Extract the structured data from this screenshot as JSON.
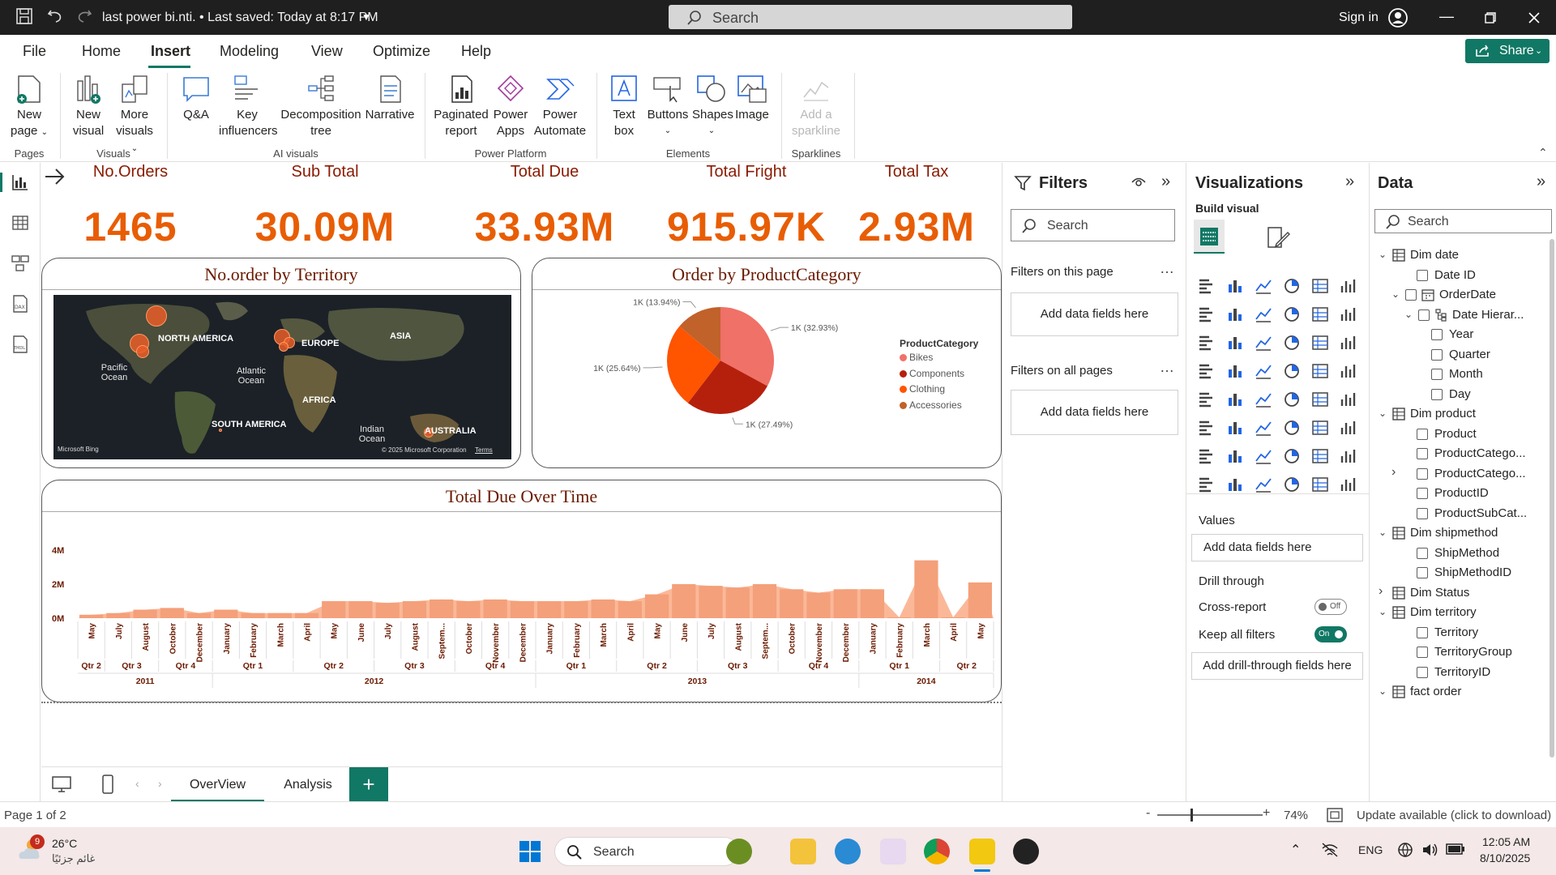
{
  "titlebar": {
    "doc_title": "last power bi.nti. • Last saved: Today at 8:17 PM",
    "search_placeholder": "Search",
    "signin": "Sign in"
  },
  "menu": {
    "tabs": [
      "File",
      "Home",
      "Insert",
      "Modeling",
      "View",
      "Optimize",
      "Help"
    ],
    "active": "Insert",
    "share": "Share"
  },
  "ribbon": {
    "buttons": {
      "new_page": [
        "New",
        "page"
      ],
      "new_visual": [
        "New",
        "visual"
      ],
      "more_visuals": [
        "More",
        "visuals"
      ],
      "qa": [
        "Q&A"
      ],
      "key_influencers": [
        "Key",
        "influencers"
      ],
      "decomposition_tree": [
        "Decomposition",
        "tree"
      ],
      "narrative": [
        "Narrative"
      ],
      "paginated_report": [
        "Paginated",
        "report"
      ],
      "power_apps": [
        "Power",
        "Apps"
      ],
      "power_automate": [
        "Power",
        "Automate"
      ],
      "text_box": [
        "Text",
        "box"
      ],
      "buttons": [
        "Buttons"
      ],
      "shapes": [
        "Shapes"
      ],
      "image": [
        "Image"
      ],
      "add_sparkline": [
        "Add a",
        "sparkline"
      ]
    },
    "groups": {
      "pages": "Pages",
      "visuals": "Visuals",
      "ai_visuals": "AI visuals",
      "power_platform": "Power Platform",
      "elements": "Elements",
      "sparklines": "Sparklines"
    }
  },
  "kpis": [
    {
      "label": "No.Orders",
      "value": "1465"
    },
    {
      "label": "Sub Total",
      "value": "30.09M"
    },
    {
      "label": "Total Due",
      "value": "33.93M"
    },
    {
      "label": "Total Fright",
      "value": "915.97K"
    },
    {
      "label": "Total Tax",
      "value": "2.93M"
    }
  ],
  "map_panel": {
    "title": "No.order by Territory",
    "labels": {
      "north_america": "NORTH AMERICA",
      "europe": "EUROPE",
      "asia": "ASIA",
      "africa": "AFRICA",
      "south_america": "SOUTH AMERICA",
      "australia": "AUSTRALIA",
      "pacific_ocean": "Pacific Ocean",
      "atlantic_ocean": "Atlantic Ocean",
      "indian_ocean": "Indian Ocean"
    },
    "bing": "Microsoft Bing",
    "copyright": "© 2025 Microsoft Corporation",
    "terms": "Terms"
  },
  "pie_panel": {
    "title": "Order by ProductCategory",
    "legend_title": "ProductCategory",
    "chart_data": {
      "type": "pie",
      "slices": [
        {
          "name": "Bikes",
          "label": "1K (32.93%)",
          "value": 32.93,
          "color": "#f07167"
        },
        {
          "name": "Components",
          "label": "1K (27.49%)",
          "value": 27.49,
          "color": "#b5200d"
        },
        {
          "name": "Clothing",
          "label": "1K (25.64%)",
          "value": 25.64,
          "color": "#ff5400"
        },
        {
          "name": "Accessories",
          "label": "1K (13.94%)",
          "value": 13.94,
          "color": "#c0622a"
        }
      ]
    }
  },
  "line_panel": {
    "title": "Total Due Over Time",
    "chart_data": {
      "type": "area",
      "y_ticks": [
        "4M",
        "2M",
        "0M"
      ],
      "ylim": [
        0,
        4000000
      ],
      "months": [
        "May",
        "July",
        "August",
        "October",
        "December",
        "January",
        "February",
        "March",
        "April",
        "May",
        "June",
        "July",
        "August",
        "Septem...",
        "October",
        "November",
        "December",
        "January",
        "February",
        "March",
        "April",
        "May",
        "June",
        "July",
        "August",
        "Septem...",
        "October",
        "November",
        "December",
        "January",
        "February",
        "March",
        "April",
        "May"
      ],
      "values": [
        0.2,
        0.3,
        0.5,
        0.6,
        0.3,
        0.5,
        0.3,
        0.3,
        0.3,
        1.0,
        1.0,
        0.9,
        1.0,
        1.1,
        1.0,
        1.1,
        1.0,
        1.0,
        1.0,
        1.1,
        1.0,
        1.4,
        2.0,
        1.9,
        1.8,
        2.0,
        1.7,
        1.5,
        1.7,
        1.7,
        0.05,
        3.4,
        0.05,
        2.1
      ],
      "quarters": [
        {
          "label": "Qtr 2",
          "start": 0,
          "end": 1
        },
        {
          "label": "Qtr 3",
          "start": 1,
          "end": 3
        },
        {
          "label": "Qtr 4",
          "start": 3,
          "end": 5
        },
        {
          "label": "Qtr 1",
          "start": 5,
          "end": 8
        },
        {
          "label": "Qtr 2",
          "start": 8,
          "end": 11
        },
        {
          "label": "Qtr 3",
          "start": 11,
          "end": 14
        },
        {
          "label": "Qtr 4",
          "start": 14,
          "end": 17
        },
        {
          "label": "Qtr 1",
          "start": 17,
          "end": 20
        },
        {
          "label": "Qtr 2",
          "start": 20,
          "end": 23
        },
        {
          "label": "Qtr 3",
          "start": 23,
          "end": 26
        },
        {
          "label": "Qtr 4",
          "start": 26,
          "end": 29
        },
        {
          "label": "Qtr 1",
          "start": 29,
          "end": 32
        },
        {
          "label": "Qtr 2",
          "start": 32,
          "end": 34
        }
      ],
      "years": [
        {
          "label": "2011",
          "start": 0,
          "end": 5
        },
        {
          "label": "2012",
          "start": 5,
          "end": 17
        },
        {
          "label": "2013",
          "start": 17,
          "end": 29
        },
        {
          "label": "2014",
          "start": 29,
          "end": 34
        }
      ],
      "color": "#f4a07a"
    }
  },
  "page_tabs": [
    "OverView",
    "Analysis"
  ],
  "filters": {
    "title": "Filters",
    "search": "Search",
    "on_this_page": "Filters on this page",
    "on_all_pages": "Filters on all pages",
    "add_fields": "Add data fields here"
  },
  "viz": {
    "title": "Visualizations",
    "build_visual": "Build visual",
    "values": "Values",
    "add_fields": "Add data fields here",
    "drill_through": "Drill through",
    "cross_report": "Cross-report",
    "cross_report_state": "Off",
    "keep_filters": "Keep all filters",
    "keep_filters_state": "On",
    "add_drill": "Add drill-through fields here",
    "more": "..."
  },
  "data_pane": {
    "title": "Data",
    "search": "Search",
    "tree": [
      {
        "label": "Dim date",
        "level": 0,
        "type": "table",
        "expanded": true
      },
      {
        "label": "Date ID",
        "level": 1,
        "type": "field"
      },
      {
        "label": "OrderDate",
        "level": 1,
        "type": "date",
        "expanded": true
      },
      {
        "label": "Date Hierar...",
        "level": 2,
        "type": "hierarchy",
        "expanded": true
      },
      {
        "label": "Year",
        "level": 3,
        "type": "field"
      },
      {
        "label": "Quarter",
        "level": 3,
        "type": "field"
      },
      {
        "label": "Month",
        "level": 3,
        "type": "field"
      },
      {
        "label": "Day",
        "level": 3,
        "type": "field"
      },
      {
        "label": "Dim product",
        "level": 0,
        "type": "table",
        "expanded": true
      },
      {
        "label": "Product",
        "level": 1,
        "type": "field"
      },
      {
        "label": "ProductCatego...",
        "level": 1,
        "type": "field"
      },
      {
        "label": "ProductCatego...",
        "level": 1,
        "type": "field",
        "collapsed": true
      },
      {
        "label": "ProductID",
        "level": 1,
        "type": "field"
      },
      {
        "label": "ProductSubCat...",
        "level": 1,
        "type": "field"
      },
      {
        "label": "Dim shipmethod",
        "level": 0,
        "type": "table",
        "expanded": true
      },
      {
        "label": "ShipMethod",
        "level": 1,
        "type": "field"
      },
      {
        "label": "ShipMethodID",
        "level": 1,
        "type": "field"
      },
      {
        "label": "Dim Status",
        "level": 0,
        "type": "table",
        "collapsed": true
      },
      {
        "label": "Dim territory",
        "level": 0,
        "type": "table",
        "expanded": true
      },
      {
        "label": "Territory",
        "level": 1,
        "type": "field"
      },
      {
        "label": "TerritoryGroup",
        "level": 1,
        "type": "field"
      },
      {
        "label": "TerritoryID",
        "level": 1,
        "type": "field"
      },
      {
        "label": "fact order",
        "level": 0,
        "type": "table",
        "expanded": true
      }
    ]
  },
  "statusbar": {
    "page": "Page 1 of 2",
    "zoom": "74%",
    "update": "Update available (click to download)"
  },
  "taskbar": {
    "temp": "26°C",
    "weather_badge": "9",
    "weather_text": "غائم جزئيًا",
    "search": "Search",
    "lang": "ENG",
    "time": "12:05 AM",
    "date": "8/10/2025"
  }
}
